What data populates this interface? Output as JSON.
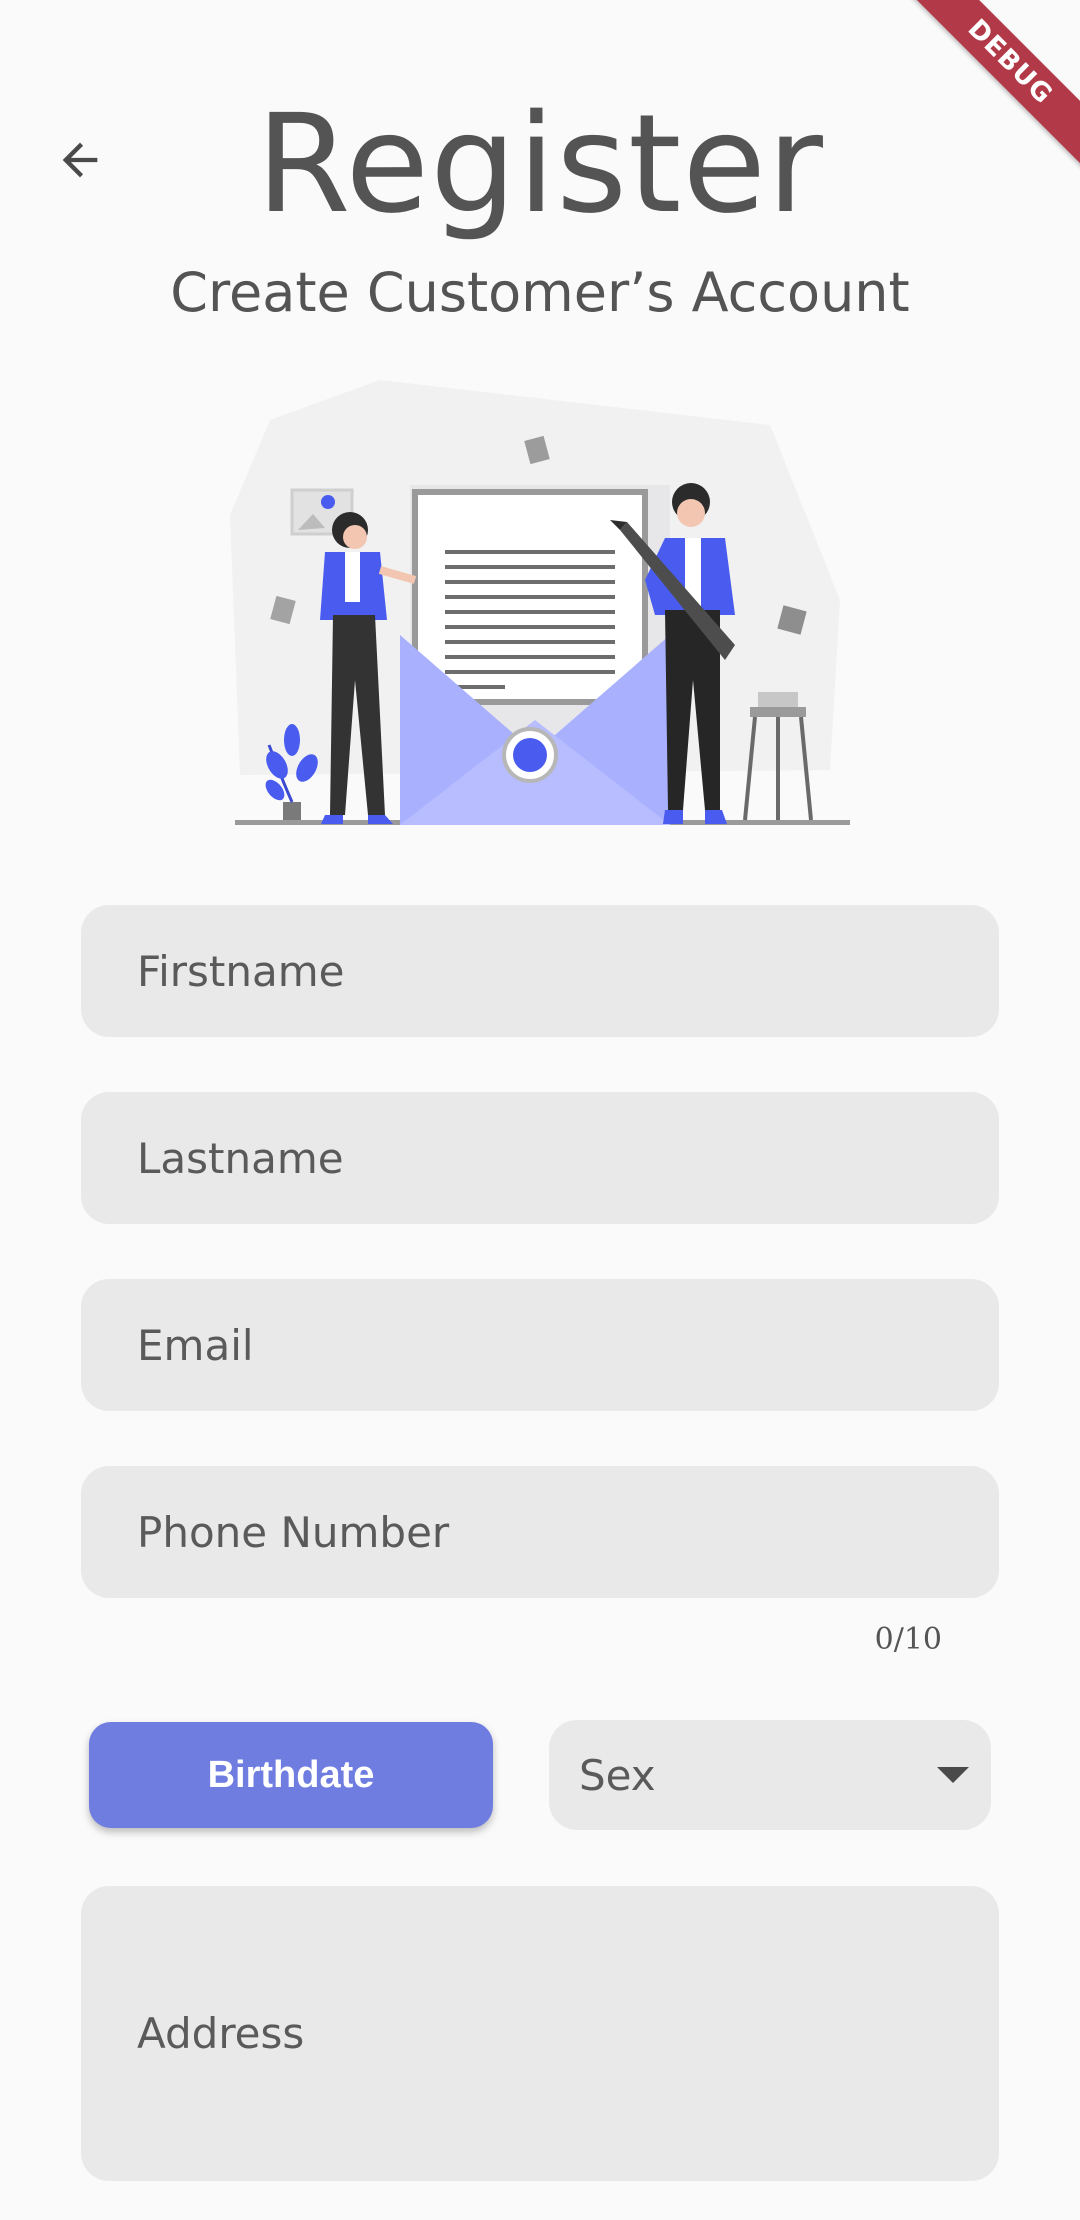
{
  "app": {
    "debug_banner": "DEBUG",
    "back_icon": "arrow-back-icon"
  },
  "header": {
    "title": "Register",
    "subtitle": "Create Customer’s Account"
  },
  "illustration": {
    "name": "register-illustration",
    "accent_color": "#4a5cf0",
    "light_accent_color": "#a9b1ff"
  },
  "form": {
    "firstname_placeholder": "Firstname",
    "lastname_placeholder": "Lastname",
    "email_placeholder": "Email",
    "phone_placeholder": "Phone Number",
    "phone_counter": "0/10",
    "birthdate_label": "Birthdate",
    "sex_placeholder": "Sex",
    "address_placeholder": "Address"
  },
  "colors": {
    "background": "#fafafa",
    "field_background": "#e9e9e9",
    "primary_button": "#6f7ce0",
    "debug_ribbon": "#b23a48",
    "text": "#545454"
  }
}
